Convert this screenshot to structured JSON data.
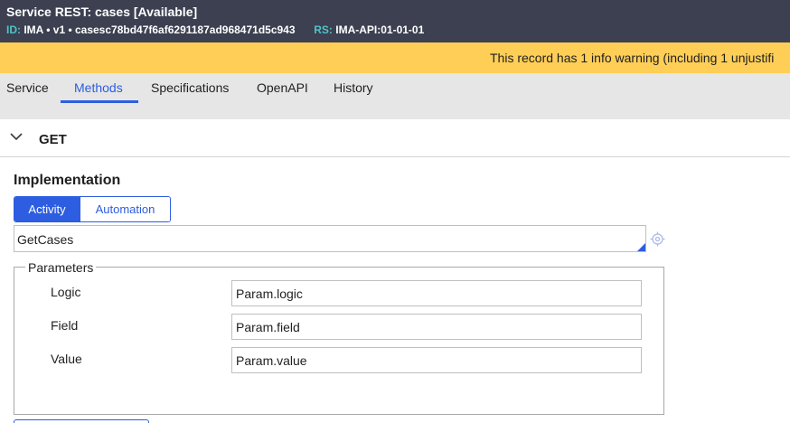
{
  "header": {
    "title": "Service REST: cases [Available]",
    "id_label": "ID:",
    "id_value": "IMA • v1 • casesc78bd47f6af6291187ad968471d5c943",
    "rs_label": "RS:",
    "rs_value": "IMA-API:01-01-01"
  },
  "warning": {
    "text": "This record has 1 info warning (including 1 unjustifi"
  },
  "tabs": [
    {
      "label": "Service"
    },
    {
      "label": "Methods"
    },
    {
      "label": "Specifications"
    },
    {
      "label": "OpenAPI"
    },
    {
      "label": "History"
    }
  ],
  "active_tab": "Methods",
  "section": {
    "title": "GET",
    "expanded": true
  },
  "implementation": {
    "label": "Implementation",
    "toggle": {
      "options": [
        "Activity",
        "Automation"
      ],
      "selected": "Activity"
    },
    "activity_value": "GetCases"
  },
  "parameters": {
    "legend": "Parameters",
    "rows": [
      {
        "label": "Logic",
        "value": "Param.logic"
      },
      {
        "label": "Field",
        "value": "Param.field"
      },
      {
        "label": "Value",
        "value": "Param.value"
      }
    ]
  },
  "colors": {
    "header_bg": "#3c4051",
    "accent": "#2d5de0",
    "warning_bg": "#ffce57",
    "id_label": "#4fc3c8"
  },
  "icons": {
    "collapse": "chevron-down-icon",
    "lookup": "crosshair-target-icon"
  }
}
